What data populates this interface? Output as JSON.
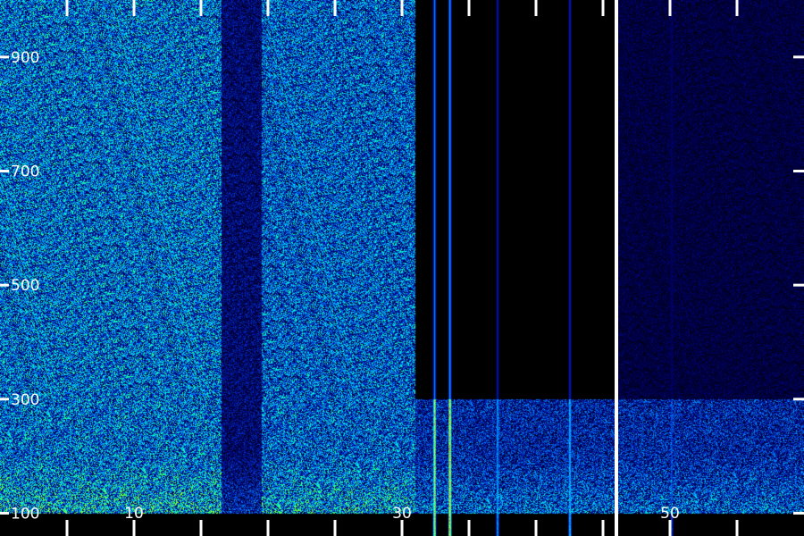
{
  "chart_data": {
    "type": "heatmap",
    "title": "",
    "xlabel": "",
    "ylabel": "",
    "x_tick_labels": [
      "10",
      "30",
      "50"
    ],
    "x_tick_values": [
      10,
      30,
      50
    ],
    "x_minor_ticks": [
      5,
      10,
      15,
      20,
      25,
      30,
      35,
      40,
      45,
      50,
      55
    ],
    "y_tick_labels": [
      "100",
      "300",
      "500",
      "700",
      "900"
    ],
    "y_tick_values": [
      100,
      300,
      500,
      700,
      900
    ],
    "xlim": [
      0,
      60
    ],
    "ylim": [
      60,
      1000
    ],
    "cursor_x": 46,
    "vertical_lines": [
      {
        "x": 32.4,
        "fmax": 1000,
        "fmax_strong": 300,
        "peak": 0.85
      },
      {
        "x": 33.55,
        "fmax": 1000,
        "fmax_strong": 300,
        "peak": 1.0
      },
      {
        "x": 37.1,
        "fmax": 1000,
        "fmax_strong": 300,
        "peak": 0.5
      },
      {
        "x": 42.5,
        "fmax": 1000,
        "fmax_strong": 300,
        "peak": 0.55
      },
      {
        "x": 50.1,
        "fmax": 1000,
        "fmax_strong": 300,
        "peak": 0.35
      }
    ],
    "noise_regions": [
      {
        "x_from": 0,
        "x_to": 16.5,
        "f_from": 100,
        "f_to": 1000,
        "level": 0.45
      },
      {
        "x_from": 16.5,
        "x_to": 19.5,
        "f_from": 100,
        "f_to": 1000,
        "level": 0.2
      },
      {
        "x_from": 19.5,
        "x_to": 31,
        "f_from": 100,
        "f_to": 1000,
        "level": 0.42
      },
      {
        "x_from": 31,
        "x_to": 60,
        "f_from": 100,
        "f_to": 300,
        "level": 0.3
      },
      {
        "x_from": 46,
        "x_to": 60,
        "f_from": 300,
        "f_to": 1000,
        "level": 0.12
      },
      {
        "x_from": 31,
        "x_to": 46,
        "f_from": 300,
        "f_to": 1000,
        "level": 0.0
      }
    ],
    "colormap": [
      "#000000",
      "#000066",
      "#0033cc",
      "#0099ff",
      "#00ffcc",
      "#66ff33",
      "#ffff00",
      "#ff6600",
      "#ff0000"
    ],
    "grid": false
  }
}
